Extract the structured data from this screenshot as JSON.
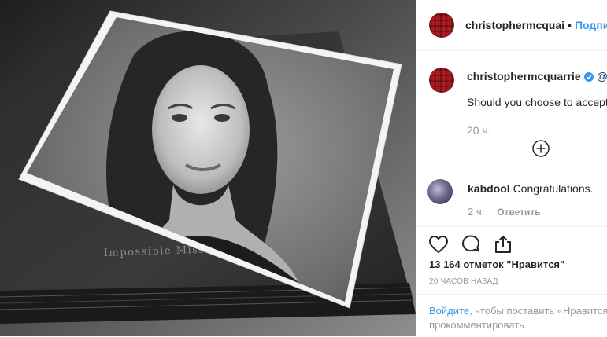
{
  "header": {
    "username": "christophermcquai",
    "separator": "•",
    "follow_label": "Подписа"
  },
  "caption": {
    "username": "christophermcquarrie",
    "mention": "@we",
    "text": "Should you choose to accept...",
    "time": "20 ч."
  },
  "photo": {
    "book_title": "Impossible Mission For"
  },
  "comments": [
    {
      "username": "kabdool",
      "text": "Congratulations.",
      "time": "2 ч.",
      "reply_label": "Ответить"
    }
  ],
  "actions": {
    "likes": "13 164 отметок \"Нравится\"",
    "post_time": "20 ЧАСОВ НАЗАД"
  },
  "login": {
    "link": "Войдите",
    "text": ", чтобы поставить «Нравится»",
    "text2": "прокомментировать."
  },
  "colors": {
    "accent": "#3897f0",
    "mention": "#003569",
    "muted": "#999999",
    "text": "#262626",
    "verified": "#3897f0"
  },
  "icons": [
    "verified-badge-icon",
    "load-more-icon",
    "heart-icon",
    "comment-icon",
    "share-icon"
  ]
}
